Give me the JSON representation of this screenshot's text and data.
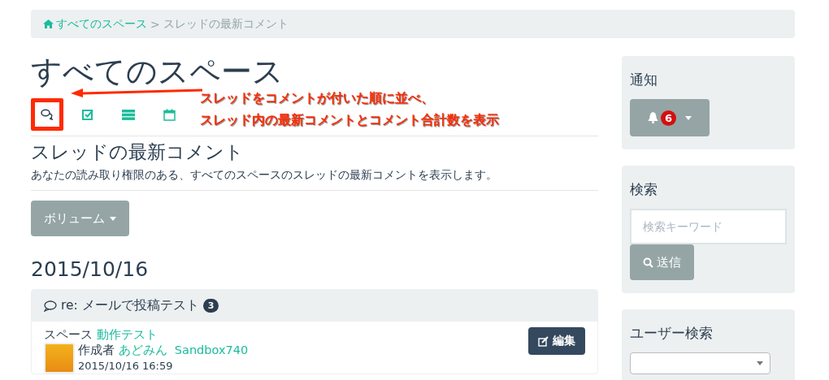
{
  "breadcrumb": {
    "home": "すべてのスペース",
    "separator": ">",
    "current": "スレッドの最新コメント"
  },
  "page_title": "すべてのスペース",
  "view_tabs": [
    {
      "kind": "comments",
      "selected": true
    },
    {
      "kind": "tasks",
      "selected": false
    },
    {
      "kind": "list",
      "selected": false
    },
    {
      "kind": "calendar",
      "selected": false
    }
  ],
  "annotation": {
    "lines": [
      "スレッドをコメントが付いた順に並べ、",
      "スレッド内の最新コメントとコメント合計数を表示"
    ]
  },
  "section_title": "スレッドの最新コメント",
  "description": "あなたの読み取り権限のある、すべてのスペースのスレッドの最新コメントを表示します。",
  "volume_button": "ボリューム",
  "date_heading": "2015/10/16",
  "thread": {
    "title": "re: メールで投稿テスト",
    "count": "3",
    "space_label": "スペース",
    "space": "動作テスト",
    "author_label": "作成者",
    "author": "あどみん",
    "author_id": "Sandbox740",
    "edit_button": "編集",
    "datetime": "2015/10/16 16:59"
  },
  "sidebar": {
    "notifications": {
      "title": "通知",
      "count": "6"
    },
    "search": {
      "title": "検索",
      "placeholder": "検索キーワード",
      "button": "送信"
    },
    "user_search": {
      "title": "ユーザー検索"
    }
  }
}
